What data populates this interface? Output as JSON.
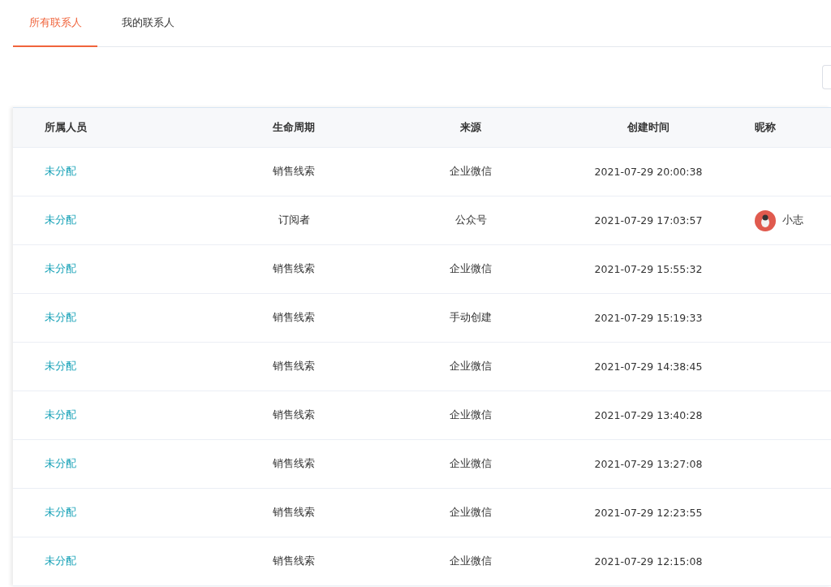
{
  "tabs": [
    {
      "label": "所有联系人",
      "selected": true
    },
    {
      "label": "我的联系人",
      "selected": false
    }
  ],
  "table": {
    "columns": [
      "所属人员",
      "生命周期",
      "来源",
      "创建时间",
      "昵称"
    ],
    "rows": [
      {
        "owner": "未分配",
        "lifecycle": "销售线索",
        "source": "企业微信",
        "created": "2021-07-29 20:00:38"
      },
      {
        "owner": "未分配",
        "lifecycle": "订阅者",
        "source": "公众号",
        "created": "2021-07-29 17:03:57",
        "nickname": "小志"
      },
      {
        "owner": "未分配",
        "lifecycle": "销售线索",
        "source": "企业微信",
        "created": "2021-07-29 15:55:32"
      },
      {
        "owner": "未分配",
        "lifecycle": "销售线索",
        "source": "手动创建",
        "created": "2021-07-29 15:19:33"
      },
      {
        "owner": "未分配",
        "lifecycle": "销售线索",
        "source": "企业微信",
        "created": "2021-07-29 14:38:45"
      },
      {
        "owner": "未分配",
        "lifecycle": "销售线索",
        "source": "企业微信",
        "created": "2021-07-29 13:40:28"
      },
      {
        "owner": "未分配",
        "lifecycle": "销售线索",
        "source": "企业微信",
        "created": "2021-07-29 13:27:08"
      },
      {
        "owner": "未分配",
        "lifecycle": "销售线索",
        "source": "企业微信",
        "created": "2021-07-29 12:23:55"
      },
      {
        "owner": "未分配",
        "lifecycle": "销售线索",
        "source": "企业微信",
        "created": "2021-07-29 12:15:08"
      }
    ]
  }
}
